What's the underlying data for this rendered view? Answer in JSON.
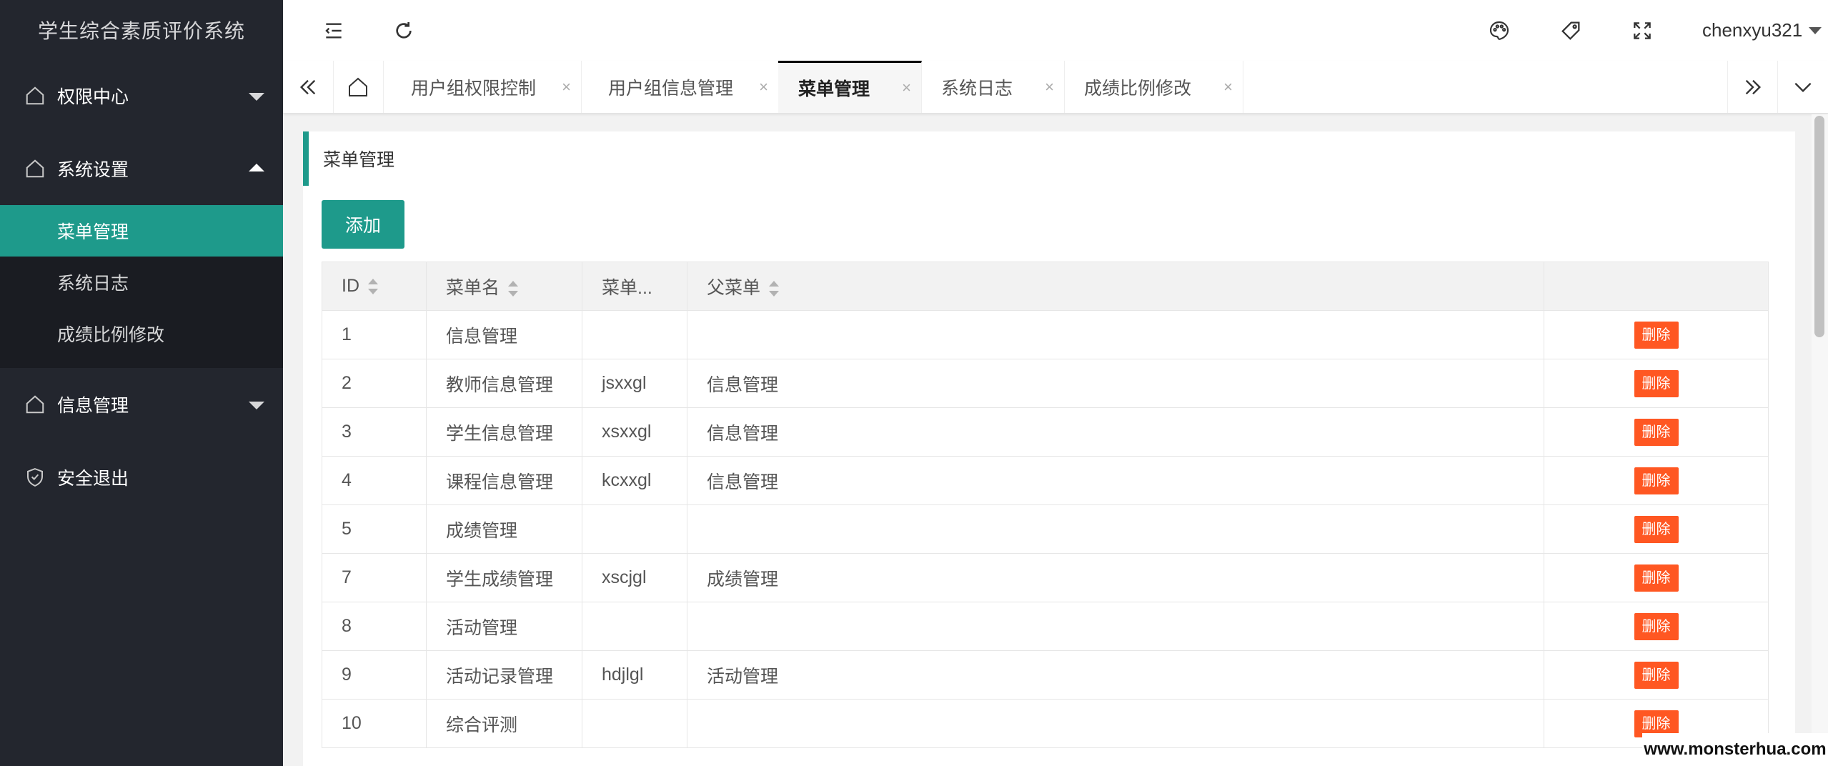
{
  "app": {
    "title": "学生综合素质评价系统"
  },
  "sidebar": {
    "groups": [
      {
        "label": "权限中心",
        "icon": "home-icon",
        "expanded": false
      },
      {
        "label": "系统设置",
        "icon": "home-icon",
        "expanded": true,
        "items": [
          {
            "label": "菜单管理",
            "active": true
          },
          {
            "label": "系统日志",
            "active": false
          },
          {
            "label": "成绩比例修改",
            "active": false
          }
        ]
      },
      {
        "label": "信息管理",
        "icon": "home-icon",
        "expanded": false
      },
      {
        "label": "安全退出",
        "icon": "shield-check-icon"
      }
    ]
  },
  "header": {
    "icons": [
      "menu-fold-icon",
      "refresh-icon",
      "palette-icon",
      "tag-icon",
      "fullscreen-icon"
    ],
    "user": "chenxyu321"
  },
  "tabs": {
    "items": [
      {
        "label": "用户组权限控制",
        "active": false
      },
      {
        "label": "用户组信息管理",
        "active": false
      },
      {
        "label": "菜单管理",
        "active": true
      },
      {
        "label": "系统日志",
        "active": false
      },
      {
        "label": "成绩比例修改",
        "active": false
      }
    ],
    "close_glyph": "×"
  },
  "main": {
    "card_title": "菜单管理",
    "add_label": "添加",
    "table": {
      "columns": [
        "ID",
        "菜单名",
        "菜单...",
        "父菜单",
        ""
      ],
      "rows": [
        {
          "id": "1",
          "name": "信息管理",
          "code": "",
          "parent": ""
        },
        {
          "id": "2",
          "name": "教师信息管理",
          "code": "jsxxgl",
          "parent": "信息管理"
        },
        {
          "id": "3",
          "name": "学生信息管理",
          "code": "xsxxgl",
          "parent": "信息管理"
        },
        {
          "id": "4",
          "name": "课程信息管理",
          "code": "kcxxgl",
          "parent": "信息管理"
        },
        {
          "id": "5",
          "name": "成绩管理",
          "code": "",
          "parent": ""
        },
        {
          "id": "7",
          "name": "学生成绩管理",
          "code": "xscjgl",
          "parent": "成绩管理"
        },
        {
          "id": "8",
          "name": "活动管理",
          "code": "",
          "parent": ""
        },
        {
          "id": "9",
          "name": "活动记录管理",
          "code": "hdjlgl",
          "parent": "活动管理"
        },
        {
          "id": "10",
          "name": "综合评测",
          "code": "",
          "parent": ""
        }
      ],
      "delete_label": "删除"
    }
  },
  "watermark": "www.monsterhua.com",
  "colors": {
    "accent": "#1e9a8b",
    "danger": "#ff5722",
    "sidebar_bg": "#23262e"
  }
}
